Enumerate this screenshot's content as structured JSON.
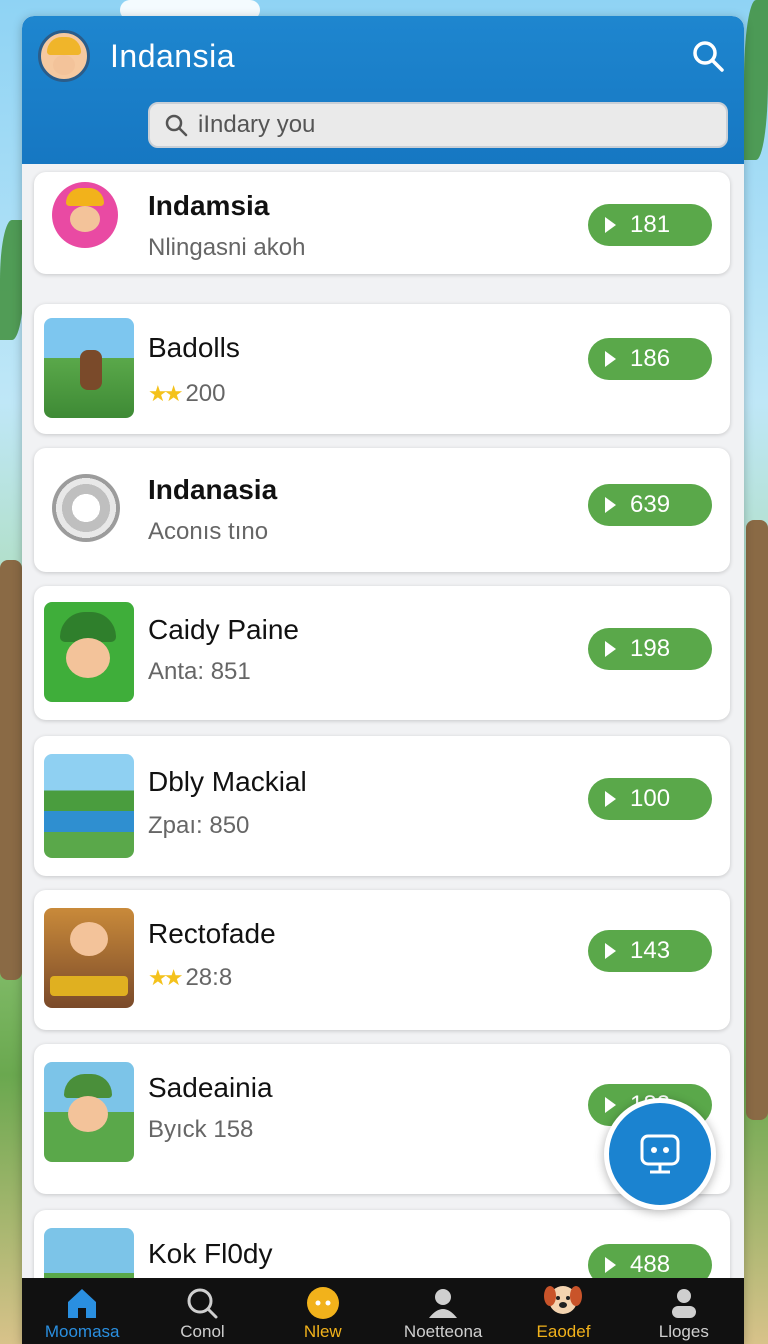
{
  "header": {
    "title": "Indansia",
    "search_placeholder": "iIndary you"
  },
  "list": [
    {
      "name": "Indamsia",
      "sub": "Nlingasni akoh",
      "stars": "",
      "play": "181",
      "name_bold": true
    },
    {
      "name": "Badolls",
      "sub": "200",
      "stars": "★★",
      "play": "186",
      "name_bold": false
    },
    {
      "name": "Indanasia",
      "sub": "Aconıs tıno",
      "stars": "",
      "play": "639",
      "name_bold": true
    },
    {
      "name": "Caidy Paine",
      "sub": "Anta: 851",
      "stars": "",
      "play": "198",
      "name_bold": false
    },
    {
      "name": "Dbly Mackial",
      "sub": "Zpaı: 850",
      "stars": "",
      "play": "100",
      "name_bold": false
    },
    {
      "name": "Rectofade",
      "sub": "28:8",
      "stars": "★★",
      "play": "143",
      "name_bold": false
    },
    {
      "name": "Sadeainia",
      "sub": "Byıck 158",
      "stars": "",
      "play": "183",
      "name_bold": false
    },
    {
      "name": "Kok Fl0dy",
      "sub": "",
      "stars": "",
      "play": "488",
      "name_bold": false
    }
  ],
  "tabs": [
    {
      "label": "Moomasa",
      "color": "#2a8fe0",
      "icon": "home-icon"
    },
    {
      "label": "Conol",
      "color": "#cfcfcf",
      "icon": "search-icon"
    },
    {
      "label": "Nlew",
      "color": "#f2b21b",
      "icon": "new-icon"
    },
    {
      "label": "Noetteona",
      "color": "#cfcfcf",
      "icon": "person-icon"
    },
    {
      "label": "Eaodef",
      "color": "#f2b21b",
      "icon": "dog-icon"
    },
    {
      "label": "Lloges",
      "color": "#cfcfcf",
      "icon": "user-icon"
    }
  ],
  "colors": {
    "header": "#1e86cf",
    "play_button": "#5aa84a",
    "fab": "#1b83d0",
    "tabbar": "#111111"
  }
}
